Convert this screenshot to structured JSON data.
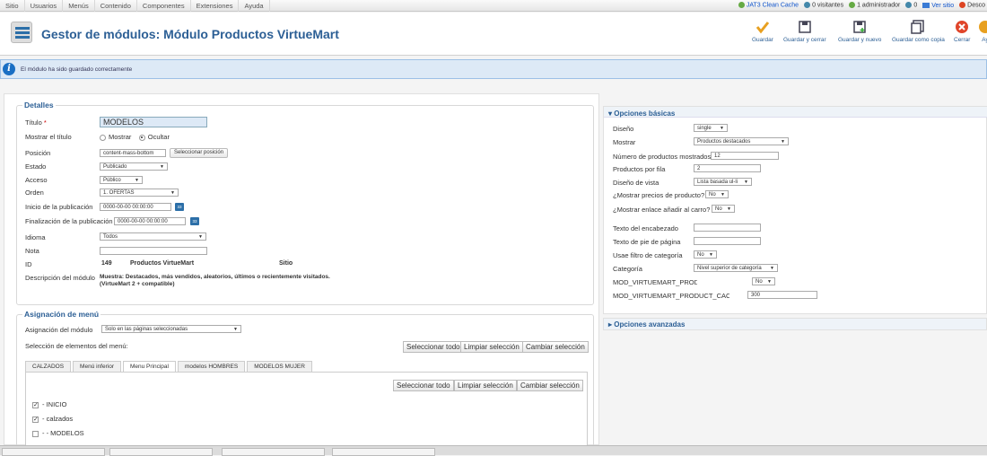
{
  "menubar": {
    "items": [
      "Sitio",
      "Usuarios",
      "Menús",
      "Contenido",
      "Componentes",
      "Extensiones",
      "Ayuda"
    ],
    "cache": "JAT3 Clean Cache",
    "visitors": "0 visitantes",
    "admins": "1 administrador",
    "messages": "0",
    "view_site": "Ver sitio",
    "logout": "Desco"
  },
  "header": {
    "title": "Gestor de módulos: Módulo Productos VirtueMart",
    "toolbar": {
      "save": "Guardar",
      "save_close": "Guardar y cerrar",
      "save_new": "Guardar y nuevo",
      "save_copy": "Guardar como copia",
      "close": "Cerrar",
      "help": "Ay"
    }
  },
  "message": "El módulo ha sido guardado correctamente",
  "details": {
    "legend": "Detalles",
    "title_label": "Título",
    "title_required": "*",
    "title_value": "MODELOS",
    "show_title_label": "Mostrar el título",
    "show": "Mostrar",
    "hide": "Ocultar",
    "position_label": "Posición",
    "position_value": "content-mass-bottom",
    "select_position": "Seleccionar posición",
    "state_label": "Estado",
    "state_value": "Publicado",
    "access_label": "Acceso",
    "access_value": "Público",
    "order_label": "Orden",
    "order_value": "1. OFERTAS",
    "start_label": "Inicio de la publicación",
    "start_value": "0000-00-00 00:00:00",
    "end_label": "Finalización de la publicación",
    "end_value": "0000-00-00 00:00:00",
    "language_label": "Idioma",
    "language_value": "Todos",
    "note_label": "Nota",
    "id_label": "ID",
    "id_value": "149",
    "module_name": "Productos VirtueMart",
    "client": "Sitio",
    "desc_label": "Descripción del módulo",
    "desc_line1": "Muestra: Destacados, más vendidos, aleatorios, últimos o recientemente visitados.",
    "desc_line2": "(VirtueMart 2 + compatible)"
  },
  "menu_assignment": {
    "legend": "Asignación de menú",
    "module_assign_label": "Asignación del módulo",
    "module_assign_value": "Solo en las páginas seleccionadas",
    "menu_select_label": "Selección de elementos del menú:",
    "select_all": "Seleccionar todo",
    "clear_selection": "Limpiar selección",
    "toggle_selection": "Cambiar selección",
    "tabs": [
      "CALZADOS",
      "Menú inferior",
      "Menu Principal",
      "modelos HOMBRES",
      "MODELOS MUJER"
    ],
    "items": [
      {
        "label": "- INICIO",
        "checked": true
      },
      {
        "label": "- calzados",
        "checked": true
      },
      {
        "label": "- - MODELOS",
        "checked": false
      }
    ]
  },
  "basic_options": {
    "heading": "Opciones básicas",
    "design_label": "Diseño",
    "design_value": "single",
    "show_label": "Mostrar",
    "show_value": "Productos destacados",
    "num_products_label": "Número de productos mostrados",
    "num_products_value": "12",
    "per_row_label": "Productos por fila",
    "per_row_value": "2",
    "view_design_label": "Diseño de vista",
    "view_design_value": "Lista basada ul-li",
    "show_prices_label": "¿Mostrar precios de producto?",
    "show_prices_value": "No",
    "show_cart_label": "¿Mostrar enlace añadir al carro?",
    "show_cart_value": "No",
    "header_text_label": "Texto del encabezado",
    "footer_text_label": "Texto de pie de página",
    "category_filter_label": "Usae filtro de categoría",
    "category_filter_value": "No",
    "category_label": "Categoría",
    "category_value": "Nivel superior de categoría",
    "caching_l_label": "MOD_VIRTUEMART_PRODUCT_CACHING_L",
    "caching_l_value": "No",
    "caching_t_label": "MOD_VIRTUEMART_PRODUCT_CACHING_T",
    "caching_t_value": "300"
  },
  "advanced_options": {
    "heading": "Opciones avanzadas"
  }
}
